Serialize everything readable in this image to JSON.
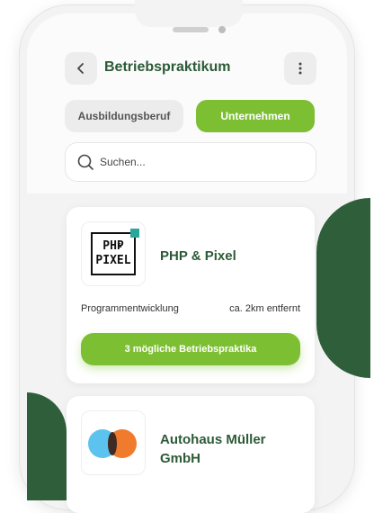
{
  "header": {
    "title": "Betriebspraktikum",
    "back_icon": "chevron-left-icon",
    "menu_icon": "more-vertical-icon"
  },
  "tabs": [
    {
      "label": "Ausbildungsberuf",
      "active": false
    },
    {
      "label": "Unternehmen",
      "active": true
    }
  ],
  "search": {
    "placeholder": "Suchen...",
    "icon": "search-icon"
  },
  "companies": [
    {
      "name": "PHP & Pixel",
      "logo_text": [
        "PHP",
        "PIXEL"
      ],
      "logo_small": "&",
      "category": "Programmentwicklung",
      "distance": "ca. 2km entfernt",
      "cta_label": "3 mögliche Betriebspraktika"
    },
    {
      "name": "Autohaus Müller GmbH",
      "logo": "venn-logo"
    }
  ],
  "colors": {
    "accent": "#7dbf32",
    "brand_dark": "#2f5f3a",
    "title": "#2c5a36"
  }
}
